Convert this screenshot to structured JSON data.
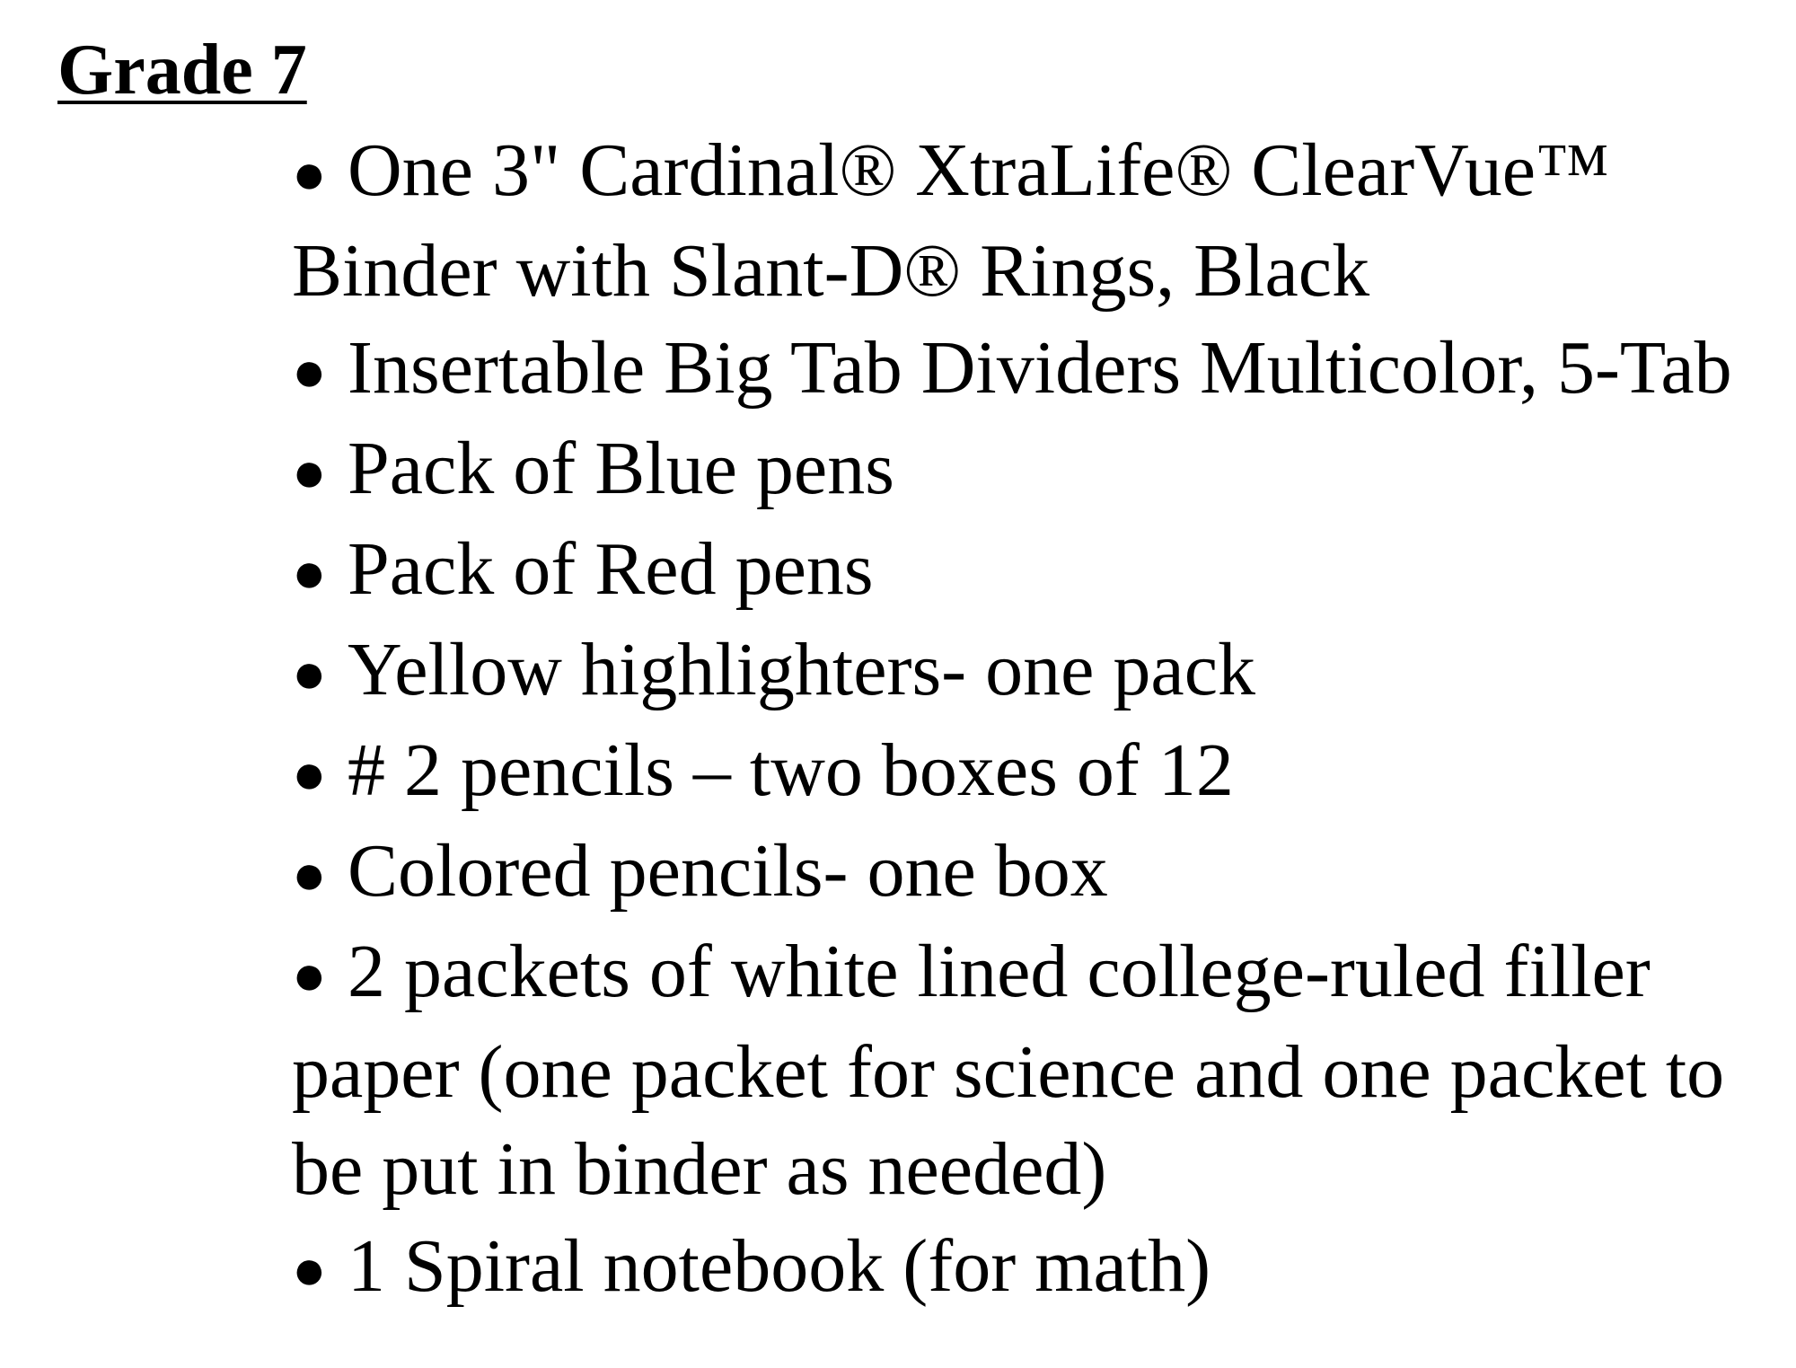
{
  "document": {
    "heading": "Grade 7",
    "bullet_glyph": "●",
    "items": [
      "One 3\" Cardinal® XtraLife® ClearVue™ Binder with Slant-D® Rings, Black",
      "Insertable Big Tab Dividers Multicolor, 5-Tab",
      "Pack of Blue pens",
      "Pack of Red pens",
      "Yellow highlighters- one pack",
      "# 2 pencils – two boxes of 12",
      "Colored pencils- one box",
      "2 packets of white lined college-ruled filler paper (one packet for science and one packet to be put in binder as needed)",
      "1 Spiral notebook  (for math)"
    ]
  }
}
